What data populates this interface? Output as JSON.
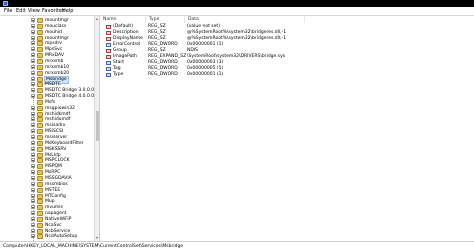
{
  "menu": [
    "File",
    "Edit",
    "View",
    "Favorites",
    "Help"
  ],
  "tree": {
    "items": [
      {
        "label": "mountmgr",
        "expandable": true
      },
      {
        "label": "mouclass",
        "expandable": true
      },
      {
        "label": "mouhid",
        "expandable": true
      },
      {
        "label": "mountmgr",
        "expandable": true
      },
      {
        "label": "mpsdrv",
        "expandable": true
      },
      {
        "label": "MpsSvc",
        "expandable": true
      },
      {
        "label": "MRxDAV",
        "expandable": true
      },
      {
        "label": "mrxsmb",
        "expandable": true
      },
      {
        "label": "mrxsmb10",
        "expandable": true
      },
      {
        "label": "mrxsmb20",
        "expandable": true
      },
      {
        "label": "Msbridge",
        "expandable": true,
        "selected": true
      },
      {
        "label": "MSDTC",
        "expandable": true
      },
      {
        "label": "MSDTC Bridge 3.0.0.0",
        "expandable": true
      },
      {
        "label": "MSDTC Bridge 4.0.0.0",
        "expandable": true
      },
      {
        "label": "Msfs",
        "expandable": false
      },
      {
        "label": "msgpiowin32",
        "expandable": true
      },
      {
        "label": "mshidkmdf",
        "expandable": true
      },
      {
        "label": "mshidumdf",
        "expandable": true
      },
      {
        "label": "msisadrv",
        "expandable": true
      },
      {
        "label": "MSiSCSI",
        "expandable": true
      },
      {
        "label": "msiserver",
        "expandable": true
      },
      {
        "label": "MsKeyboardFilter",
        "expandable": true
      },
      {
        "label": "MSKSSRV",
        "expandable": true
      },
      {
        "label": "MsLldp",
        "expandable": true
      },
      {
        "label": "MSPCLOCK",
        "expandable": true
      },
      {
        "label": "MSPQM",
        "expandable": true
      },
      {
        "label": "MsRPC",
        "expandable": true
      },
      {
        "label": "MSSGDAVIA",
        "expandable": true
      },
      {
        "label": "mssmbios",
        "expandable": true
      },
      {
        "label": "MSTEE",
        "expandable": true
      },
      {
        "label": "MTConfig",
        "expandable": true
      },
      {
        "label": "Mup",
        "expandable": true
      },
      {
        "label": "mvumis",
        "expandable": true
      },
      {
        "label": "napagent",
        "expandable": true
      },
      {
        "label": "NativeWiFiP",
        "expandable": true
      },
      {
        "label": "NcaSvc",
        "expandable": true
      },
      {
        "label": "NcbService",
        "expandable": true
      },
      {
        "label": "NcdAutoSetup",
        "expandable": true
      }
    ]
  },
  "columns": {
    "name": "Name",
    "type": "Type",
    "data": "Data"
  },
  "values": [
    {
      "name": "(Default)",
      "type": "REG_SZ",
      "data": "(value not set)",
      "kind": "str"
    },
    {
      "name": "Description",
      "type": "REG_SZ",
      "data": "@%SystemRoot%\\system32\\bridgeres.dll,-1",
      "kind": "str"
    },
    {
      "name": "DisplayName",
      "type": "REG_SZ",
      "data": "@%SystemRoot%\\system32\\bridgeres.dll,-1",
      "kind": "str"
    },
    {
      "name": "ErrorControl",
      "type": "REG_DWORD",
      "data": "0x00000001 (1)",
      "kind": "bin"
    },
    {
      "name": "Group",
      "type": "REG_SZ",
      "data": "NDIS",
      "kind": "str"
    },
    {
      "name": "ImagePath",
      "type": "REG_EXPAND_SZ",
      "data": "\\SystemRoot\\system32\\DRIVERS\\bridge.sys",
      "kind": "str"
    },
    {
      "name": "Start",
      "type": "REG_DWORD",
      "data": "0x00000003 (3)",
      "kind": "bin"
    },
    {
      "name": "Tag",
      "type": "REG_DWORD",
      "data": "0x00000005 (5)",
      "kind": "bin"
    },
    {
      "name": "Type",
      "type": "REG_DWORD",
      "data": "0x00000001 (1)",
      "kind": "bin"
    }
  ],
  "status": "Computer\\HKEY_LOCAL_MACHINE\\SYSTEM\\CurrentControlSet\\Services\\Msbridge"
}
